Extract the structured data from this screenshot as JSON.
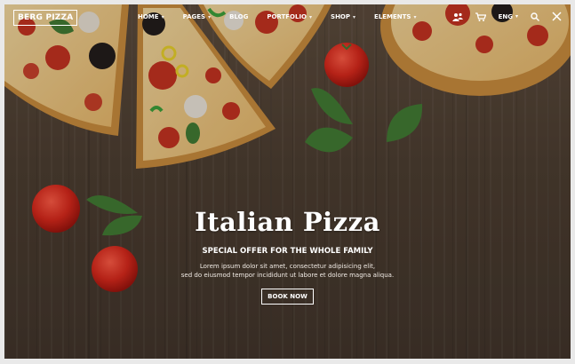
{
  "header": {
    "logo_text": "BERG PIZZA",
    "nav": [
      {
        "label": "HOME",
        "has_dropdown": true
      },
      {
        "label": "PAGES",
        "has_dropdown": true
      },
      {
        "label": "BLOG",
        "has_dropdown": false
      },
      {
        "label": "PORTFOLIO",
        "has_dropdown": true
      },
      {
        "label": "SHOP",
        "has_dropdown": true
      },
      {
        "label": "ELEMENTS",
        "has_dropdown": true
      }
    ],
    "language": "ENG",
    "icons": [
      "people-icon",
      "cart-icon",
      "search-icon",
      "close-icon"
    ]
  },
  "hero": {
    "title": "Italian Pizza",
    "subtitle": "SPECIAL OFFER FOR THE WHOLE FAMILY",
    "description_line1": "Lorem ipsum dolor sit amet, consectetur adipisicing elit,",
    "description_line2": "sed do eiusmod tempor incididunt ut labore et dolore magna aliqua.",
    "button_label": "BOOK NOW"
  },
  "colors": {
    "wood_dark": "#4a3c30",
    "crust": "#d89a4a",
    "tomato": "#c8241c",
    "basil": "#3f7a32"
  }
}
